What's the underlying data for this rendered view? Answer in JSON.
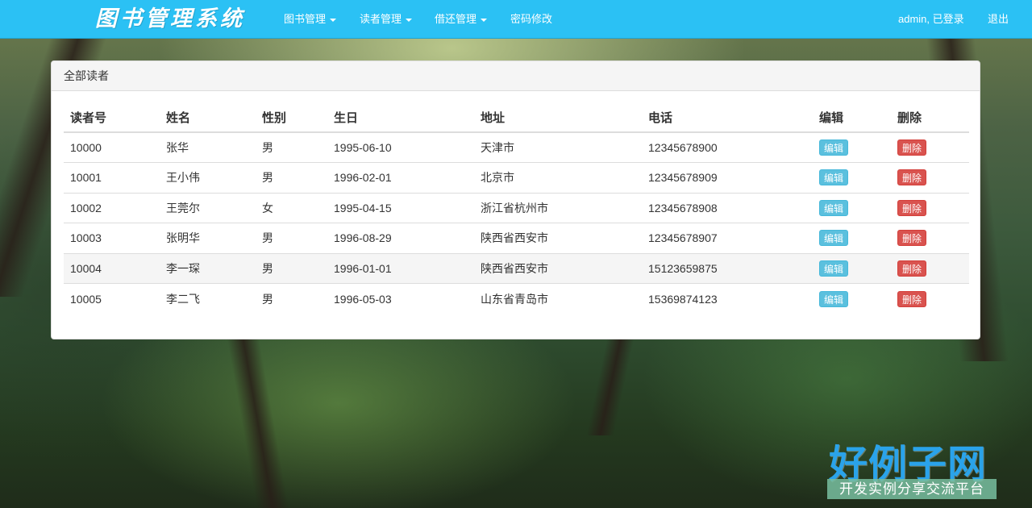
{
  "brand": "图书管理系统",
  "nav": {
    "items": [
      {
        "label": "图书管理",
        "dropdown": true
      },
      {
        "label": "读者管理",
        "dropdown": true
      },
      {
        "label": "借还管理",
        "dropdown": true
      },
      {
        "label": "密码修改",
        "dropdown": false
      }
    ],
    "user_status": "admin, 已登录",
    "logout": "退出"
  },
  "panel": {
    "title": "全部读者",
    "columns": [
      "读者号",
      "姓名",
      "性别",
      "生日",
      "地址",
      "电话",
      "编辑",
      "删除"
    ],
    "edit_label": "编辑",
    "delete_label": "删除",
    "rows": [
      {
        "id": "10000",
        "name": "张华",
        "gender": "男",
        "birthday": "1995-06-10",
        "address": "天津市",
        "phone": "12345678900"
      },
      {
        "id": "10001",
        "name": "王小伟",
        "gender": "男",
        "birthday": "1996-02-01",
        "address": "北京市",
        "phone": "12345678909"
      },
      {
        "id": "10002",
        "name": "王莞尔",
        "gender": "女",
        "birthday": "1995-04-15",
        "address": "浙江省杭州市",
        "phone": "12345678908"
      },
      {
        "id": "10003",
        "name": "张明华",
        "gender": "男",
        "birthday": "1996-08-29",
        "address": "陕西省西安市",
        "phone": "12345678907"
      },
      {
        "id": "10004",
        "name": "李一琛",
        "gender": "男",
        "birthday": "1996-01-01",
        "address": "陕西省西安市",
        "phone": "15123659875"
      },
      {
        "id": "10005",
        "name": "李二飞",
        "gender": "男",
        "birthday": "1996-05-03",
        "address": "山东省青岛市",
        "phone": "15369874123"
      }
    ],
    "highlighted_row_index": 4
  },
  "watermark": {
    "title": "好例子网",
    "subtitle": "开发实例分享交流平台"
  },
  "colors": {
    "navbar": "#2bc1f4",
    "edit_button": "#5bc0de",
    "delete_button": "#d9534f"
  }
}
